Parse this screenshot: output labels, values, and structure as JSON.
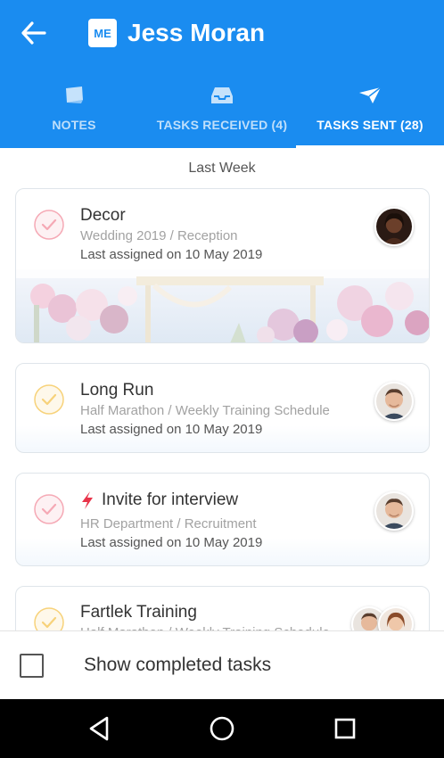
{
  "header": {
    "badge": "ME",
    "title": "Jess Moran",
    "color": "#1a8cf0"
  },
  "tabs": [
    {
      "label": "NOTES",
      "icon": "notes-icon",
      "active": false
    },
    {
      "label": "TASKS RECEIVED (4)",
      "icon": "inbox-tray-icon",
      "active": false
    },
    {
      "label": "TASKS SENT (28)",
      "icon": "paper-plane-icon",
      "active": true
    }
  ],
  "section": "Last Week",
  "tasks": [
    {
      "title": "Decor",
      "path": "Wedding 2019 / Reception",
      "assigned": "Last assigned on 10 May 2019",
      "check_color": "#f5a9b5",
      "avatar": "woman-avatar"
    },
    {
      "title": "Long Run",
      "path": "Half Marathon / Weekly Training Schedule",
      "assigned": "Last assigned on 10 May 2019",
      "check_color": "#f7d27a",
      "avatar": "man-avatar"
    },
    {
      "title": "Invite for interview",
      "path": "HR Department / Recruitment",
      "assigned": "Last assigned on 10 May 2019",
      "check_color": "#f5a9b5",
      "avatar": "man-avatar",
      "urgent": true
    },
    {
      "title": "Fartlek Training",
      "path": "Half Marathon / Weekly Training Schedule",
      "assigned": "",
      "check_color": "#f7d27a",
      "avatar": "two-avatars"
    }
  ],
  "footer": {
    "show_completed": "Show completed tasks",
    "checked": false
  },
  "system_nav": [
    "back-triangle-icon",
    "home-circle-icon",
    "recents-square-icon"
  ]
}
